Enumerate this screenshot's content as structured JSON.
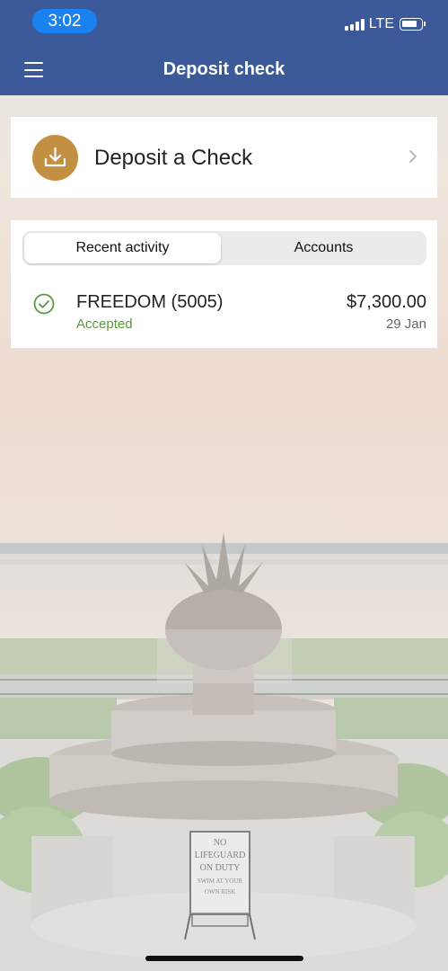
{
  "status_bar": {
    "time": "3:02",
    "network": "LTE"
  },
  "header": {
    "title": "Deposit check",
    "menu_icon": "hamburger-menu-icon"
  },
  "deposit": {
    "label": "Deposit a Check",
    "icon": "download-icon",
    "accent": "#c39042"
  },
  "tabs": [
    {
      "label": "Recent activity",
      "selected": true
    },
    {
      "label": "Accounts",
      "selected": false
    }
  ],
  "activity": [
    {
      "name": "FREEDOM (5005)",
      "status": "Accepted",
      "amount": "$7,300.00",
      "date": "29 Jan",
      "status_color": "#5a9a3f"
    }
  ],
  "background_sign": {
    "lines": [
      "NO",
      "LIFEGUARD",
      "ON DUTY",
      "SWIM AT YOUR",
      "OWN RISK"
    ]
  },
  "colors": {
    "header": "#3c5a9a",
    "time_pill": "#1a82f0"
  }
}
